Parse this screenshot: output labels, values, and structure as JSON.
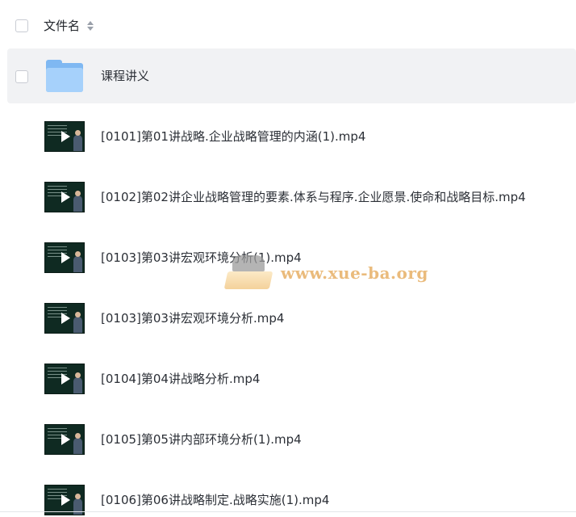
{
  "header": {
    "column_label": "文件名",
    "sort_icon": "sort-icon"
  },
  "folder": {
    "name": "课程讲义",
    "icon": "folder-icon"
  },
  "files": [
    {
      "name": "[0101]第01讲战略.企业战略管理的内涵(1).mp4"
    },
    {
      "name": "[0102]第02讲企业战略管理的要素.体系与程序.企业愿景.使命和战略目标.mp4"
    },
    {
      "name": "[0103]第03讲宏观环境分析(1).mp4"
    },
    {
      "name": "[0103]第03讲宏观环境分析.mp4"
    },
    {
      "name": "[0104]第04讲战略分析.mp4"
    },
    {
      "name": "[0105]第05讲内部环境分析(1).mp4"
    },
    {
      "name": "[0106]第06讲战略制定.战略实施(1).mp4"
    }
  ],
  "watermark": {
    "text": "www.xue-ba.org"
  },
  "colors": {
    "selected_row_bg": "#f1f2f4",
    "folder_blue": "#a6d1fb",
    "watermark_orange": "#e2a14a"
  }
}
